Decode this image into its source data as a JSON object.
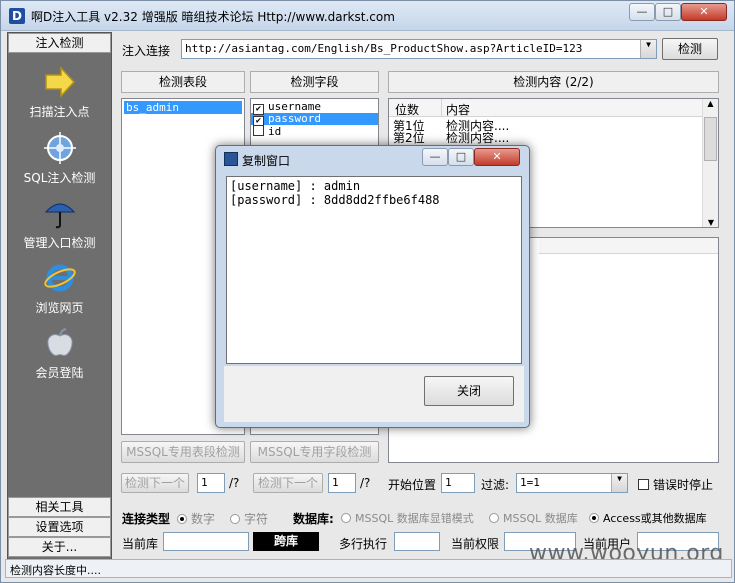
{
  "window": {
    "title": "啊D注入工具 v2.32 增强版 暗组技术论坛 Http://www.darkst.com",
    "min": "—",
    "max": "□",
    "close": "✕"
  },
  "sidebar": {
    "top_label": "注入检测",
    "items": [
      {
        "label": "扫描注入点",
        "icon": "arrow-right-icon"
      },
      {
        "label": "SQL注入检测",
        "icon": "globe-target-icon"
      },
      {
        "label": "管理入口检测",
        "icon": "umbrella-icon"
      },
      {
        "label": "浏览网页",
        "icon": "ie-icon"
      },
      {
        "label": "会员登陆",
        "icon": "apple-icon"
      }
    ],
    "bottom": [
      "相关工具",
      "设置选项",
      "关于..."
    ]
  },
  "toolbar": {
    "url_label": "注入连接",
    "url": "http://asiantag.com/English/Bs_ProductShow.asp?ArticleID=123",
    "check_button": "检测"
  },
  "tables_panel": {
    "header": "检测表段",
    "items": [
      "bs_admin"
    ],
    "button": "MSSQL专用表段检测"
  },
  "fields_panel": {
    "header": "检测字段",
    "items": [
      {
        "label": "username",
        "checked": true
      },
      {
        "label": "password",
        "checked": true
      },
      {
        "label": "id",
        "checked": false
      }
    ],
    "button": "MSSQL专用字段检测"
  },
  "content_panel": {
    "header": "检测内容 (2/2)",
    "columns": [
      "位数",
      "内容"
    ],
    "rows": [
      [
        "第1位",
        "检测内容...."
      ],
      [
        "第2位",
        "检测内容...."
      ]
    ]
  },
  "nav_row": {
    "next1": "检测下一个",
    "num1": "1",
    "q1": "/?",
    "next2": "检测下一个",
    "num2": "1",
    "q2": "/?",
    "start_label": "开始位置",
    "start_value": "1",
    "filter_label": "过滤:",
    "filter_value": "1=1",
    "stop_on_error": "错误时停止"
  },
  "conn_row": {
    "type_label": "连接类型",
    "opt_number": "数字",
    "opt_string": "字符",
    "db_label": "数据库:",
    "db_opt1": "MSSQL 数据库显错模式",
    "db_opt2": "MSSQL 数据库",
    "db_opt3": "Access或其他数据库"
  },
  "info_row": {
    "cur_db": "当前库",
    "cross_db": "跨库",
    "multi_exec": "多行执行",
    "cur_perm": "当前权限",
    "cur_user": "当前用户"
  },
  "dialog": {
    "title": "复制窗口",
    "text": "[username] : admin\n[password] : 8dd8dd2ffbe6f488",
    "close_button": "关闭"
  },
  "status": "检测内容长度中....",
  "watermark": "www.wooyun.org"
}
